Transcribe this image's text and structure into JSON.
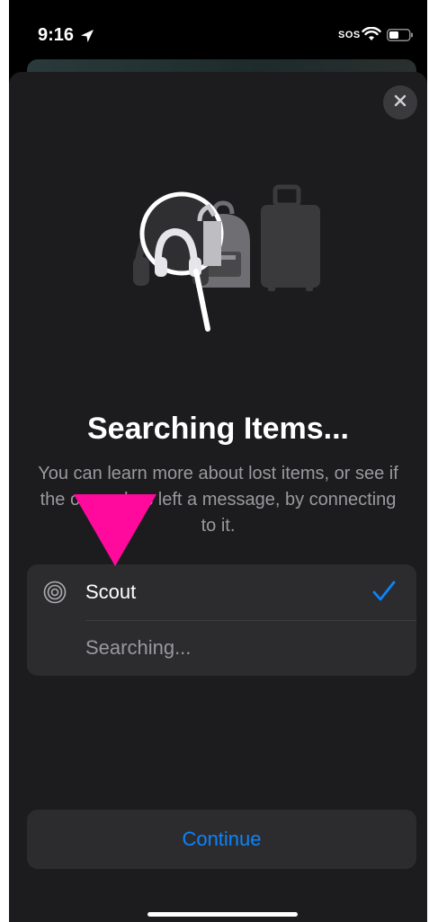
{
  "status_bar": {
    "time": "9:16",
    "sos": "SOS",
    "icons": [
      "location-arrow-icon",
      "wifi-icon",
      "battery-icon"
    ]
  },
  "sheet": {
    "close_icon": "close-icon",
    "illustration_icons": [
      "magnifier-icon",
      "headphones-icon",
      "backpack-icon",
      "suitcase-icon"
    ],
    "title": "Searching Items...",
    "subtitle": "You can learn more about lost items, or see if the owner has left a message, by connecting to it.",
    "item": {
      "icon": "airtag-icon",
      "name": "Scout",
      "status": "Searching...",
      "selected": true
    },
    "continue_label": "Continue"
  },
  "colors": {
    "accent": "#0a84ff",
    "sheet_background": "#1c1c1e",
    "card_background": "#2c2c2e",
    "pointer": "#ff0a9c"
  }
}
